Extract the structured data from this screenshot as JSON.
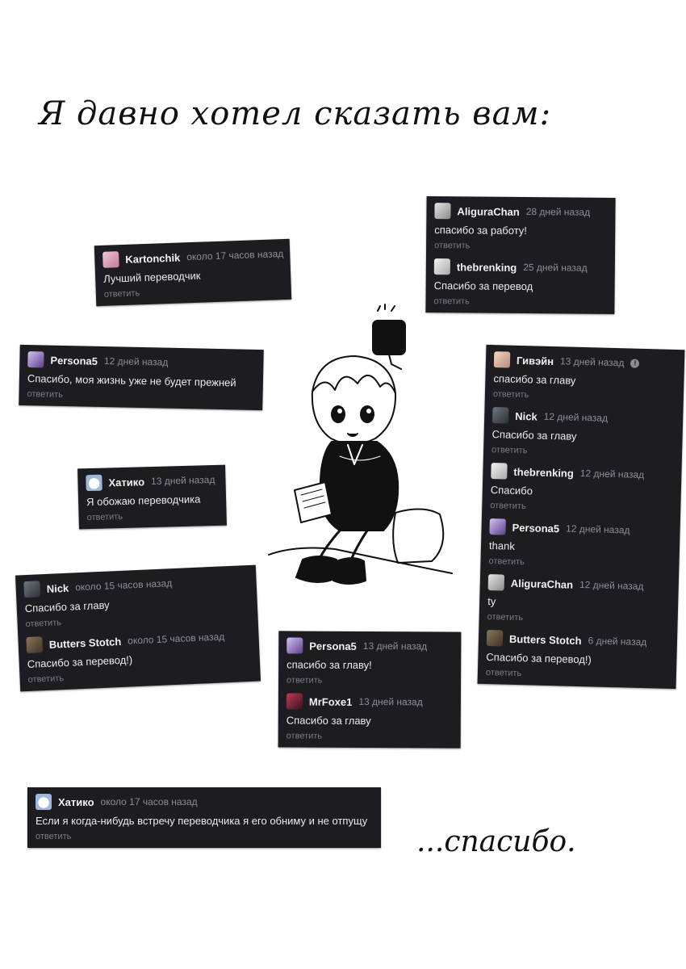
{
  "heading": "Я давно хотел сказать вам:",
  "footer": "...спасибо.",
  "reply_label": "ответить",
  "colors": {
    "card_bg": "#1c1c21",
    "text": "#ececf0",
    "meta": "#8d8d96"
  },
  "cards": {
    "kartonchik": [
      {
        "user": "Kartonchik",
        "time": "около 17 часов назад",
        "text": "Лучший переводчик",
        "avatar": "pink-avatar-icon"
      }
    ],
    "aligura_thebrenking": [
      {
        "user": "AliguraChan",
        "time": "28 дней назад",
        "text": "спасибо за работу!",
        "avatar": "grey-avatar-icon"
      },
      {
        "user": "thebrenking",
        "time": "25 дней назад",
        "text": "Спасибо за перевод",
        "avatar": "light-avatar-icon"
      }
    ],
    "persona5_life": [
      {
        "user": "Persona5",
        "time": "12 дней назад",
        "text": "Спасибо, моя жизнь уже не будет прежней",
        "avatar": "purple-avatar-icon"
      }
    ],
    "hatiko_love": [
      {
        "user": "Хатико",
        "time": "13 дней назад",
        "text": "Я обожаю переводчика",
        "avatar": "panda-avatar-icon"
      }
    ],
    "nick_butters": [
      {
        "user": "Nick",
        "time": "около 15 часов назад",
        "text": "Спасибо за главу",
        "avatar": "dark-avatar-icon"
      },
      {
        "user": "Butters Stotch",
        "time": "около 15 часов назад",
        "text": "Спасибо за перевод!)",
        "avatar": "brown-avatar-icon"
      }
    ],
    "persona5_mrfoxe": [
      {
        "user": "Persona5",
        "time": "13 дней назад",
        "text": "спасибо за главу!",
        "avatar": "purple-avatar-icon"
      },
      {
        "user": "MrFoxe1",
        "time": "13 дней назад",
        "text": "Спасибо за главу",
        "avatar": "red-avatar-icon"
      }
    ],
    "right_column": [
      {
        "user": "Гивэйн",
        "time": "13 дней назад",
        "text": "спасибо за главу",
        "avatar": "pink-avatar-icon",
        "warn": "!"
      },
      {
        "user": "Nick",
        "time": "12 дней назад",
        "text": "Спасибо за главу",
        "avatar": "dark-avatar-icon"
      },
      {
        "user": "thebrenking",
        "time": "12 дней назад",
        "text": "Спасибо",
        "avatar": "light-avatar-icon"
      },
      {
        "user": "Persona5",
        "time": "12 дней назад",
        "text": "thank",
        "avatar": "purple-avatar-icon"
      },
      {
        "user": "AliguraChan",
        "time": "12 дней назад",
        "text": "ty",
        "avatar": "grey-avatar-icon"
      },
      {
        "user": "Butters Stotch",
        "time": "6 дней назад",
        "text": "Спасибо за перевод!)",
        "avatar": "brown-avatar-icon"
      }
    ],
    "hatiko_hug": [
      {
        "user": "Хатико",
        "time": "около 17 часов назад",
        "text": "Если я когда-нибудь встречу переводчика я его обниму и не отпущу",
        "avatar": "panda-avatar-icon"
      }
    ]
  }
}
